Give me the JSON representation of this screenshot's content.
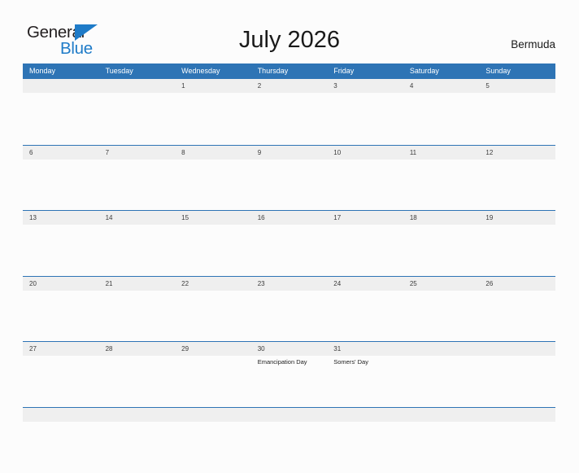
{
  "brand": {
    "name_part1": "General",
    "name_part2": "Blue",
    "flag_icon": "blue-triangle-flag-icon",
    "color_dark": "#231F20",
    "color_blue": "#1E7BC8"
  },
  "header": {
    "title": "July 2026",
    "region": "Bermuda"
  },
  "colors": {
    "header_blue": "#2E74B5",
    "row_stripe": "#EFEFEF",
    "page_background": "#FCFCFC",
    "text_dark": "#3B3B3B"
  },
  "calendar": {
    "month": "July",
    "year": "2026",
    "weekday_headers": [
      "Monday",
      "Tuesday",
      "Wednesday",
      "Thursday",
      "Friday",
      "Saturday",
      "Sunday"
    ],
    "weeks": [
      {
        "days": [
          {
            "num": "",
            "event": ""
          },
          {
            "num": "",
            "event": ""
          },
          {
            "num": "1",
            "event": ""
          },
          {
            "num": "2",
            "event": ""
          },
          {
            "num": "3",
            "event": ""
          },
          {
            "num": "4",
            "event": ""
          },
          {
            "num": "5",
            "event": ""
          }
        ]
      },
      {
        "days": [
          {
            "num": "6",
            "event": ""
          },
          {
            "num": "7",
            "event": ""
          },
          {
            "num": "8",
            "event": ""
          },
          {
            "num": "9",
            "event": ""
          },
          {
            "num": "10",
            "event": ""
          },
          {
            "num": "11",
            "event": ""
          },
          {
            "num": "12",
            "event": ""
          }
        ]
      },
      {
        "days": [
          {
            "num": "13",
            "event": ""
          },
          {
            "num": "14",
            "event": ""
          },
          {
            "num": "15",
            "event": ""
          },
          {
            "num": "16",
            "event": ""
          },
          {
            "num": "17",
            "event": ""
          },
          {
            "num": "18",
            "event": ""
          },
          {
            "num": "19",
            "event": ""
          }
        ]
      },
      {
        "days": [
          {
            "num": "20",
            "event": ""
          },
          {
            "num": "21",
            "event": ""
          },
          {
            "num": "22",
            "event": ""
          },
          {
            "num": "23",
            "event": ""
          },
          {
            "num": "24",
            "event": ""
          },
          {
            "num": "25",
            "event": ""
          },
          {
            "num": "26",
            "event": ""
          }
        ]
      },
      {
        "days": [
          {
            "num": "27",
            "event": ""
          },
          {
            "num": "28",
            "event": ""
          },
          {
            "num": "29",
            "event": ""
          },
          {
            "num": "30",
            "event": "Emancipation Day"
          },
          {
            "num": "31",
            "event": "Somers' Day"
          },
          {
            "num": "",
            "event": ""
          },
          {
            "num": "",
            "event": ""
          }
        ]
      },
      {
        "days": [
          {
            "num": "",
            "event": ""
          },
          {
            "num": "",
            "event": ""
          },
          {
            "num": "",
            "event": ""
          },
          {
            "num": "",
            "event": ""
          },
          {
            "num": "",
            "event": ""
          },
          {
            "num": "",
            "event": ""
          },
          {
            "num": "",
            "event": ""
          }
        ]
      }
    ]
  }
}
